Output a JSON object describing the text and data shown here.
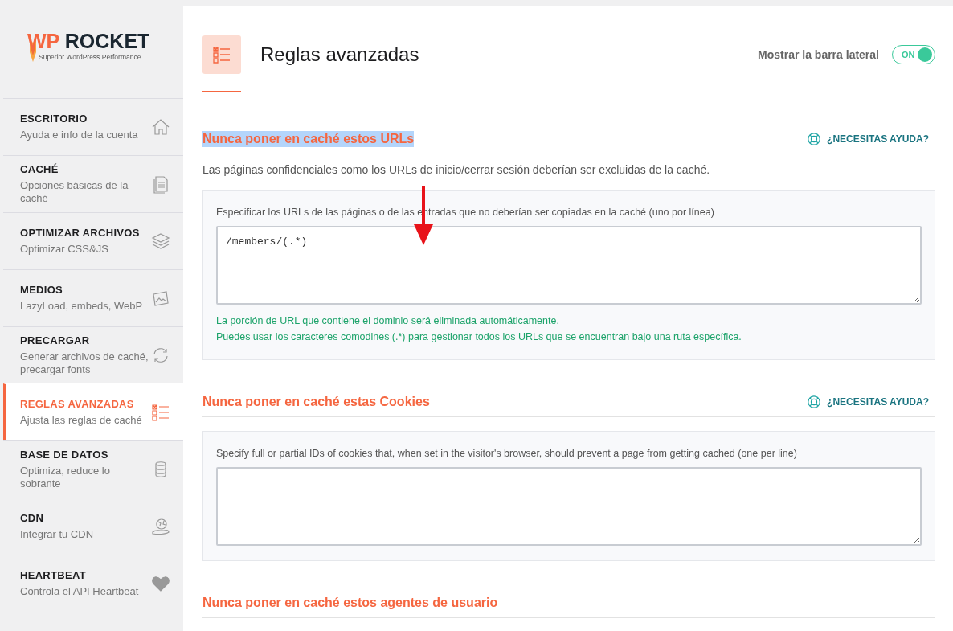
{
  "logo": {
    "brand_a": "WP",
    "brand_b": "ROCKET",
    "tagline": "Superior WordPress Performance"
  },
  "sidebar": {
    "items": [
      {
        "title": "ESCRITORIO",
        "subtitle": "Ayuda e info de la cuenta",
        "selected": false
      },
      {
        "title": "CACHÉ",
        "subtitle": "Opciones básicas de la caché",
        "selected": false
      },
      {
        "title": "OPTIMIZAR ARCHIVOS",
        "subtitle": "Optimizar CSS&JS",
        "selected": false
      },
      {
        "title": "MEDIOS",
        "subtitle": "LazyLoad, embeds, WebP",
        "selected": false
      },
      {
        "title": "PRECARGAR",
        "subtitle": "Generar archivos de caché, precargar fonts",
        "selected": false
      },
      {
        "title": "REGLAS AVANZADAS",
        "subtitle": "Ajusta las reglas de caché",
        "selected": true
      },
      {
        "title": "BASE DE DATOS",
        "subtitle": "Optimiza, reduce lo sobrante",
        "selected": false
      },
      {
        "title": "CDN",
        "subtitle": "Integrar tu CDN",
        "selected": false
      },
      {
        "title": "HEARTBEAT",
        "subtitle": "Controla el API Heartbeat",
        "selected": false
      }
    ]
  },
  "header": {
    "title": "Reglas avanzadas",
    "sidebar_toggle": {
      "label": "Mostrar la barra lateral",
      "state_text": "ON",
      "on": true
    }
  },
  "sections": [
    {
      "title": "Nunca poner en caché estos URLs",
      "highlighted": true,
      "help": "¿NECESITAS AYUDA?",
      "description": "Las páginas confidenciales como los URLs de inicio/cerrar sesión deberían ser excluidas de la caché.",
      "field_label": "Especificar los URLs de las páginas o de las entradas que no deberían ser copiadas en la caché (uno por línea)",
      "value": "/members/(.*)",
      "notes": [
        "La porción de URL que contiene el dominio será eliminada automáticamente.",
        "Puedes usar los caracteres comodines (.*) para gestionar todos los URLs que se encuentran bajo una ruta específica."
      ]
    },
    {
      "title": "Nunca poner en caché estas Cookies",
      "highlighted": false,
      "help": "¿NECESITAS AYUDA?",
      "field_label": "Specify full or partial IDs of cookies that, when set in the visitor's browser, should prevent a page from getting cached (one per line)"
    },
    {
      "title": "Nunca poner en caché estos agentes de usuario",
      "highlighted": false
    }
  ]
}
